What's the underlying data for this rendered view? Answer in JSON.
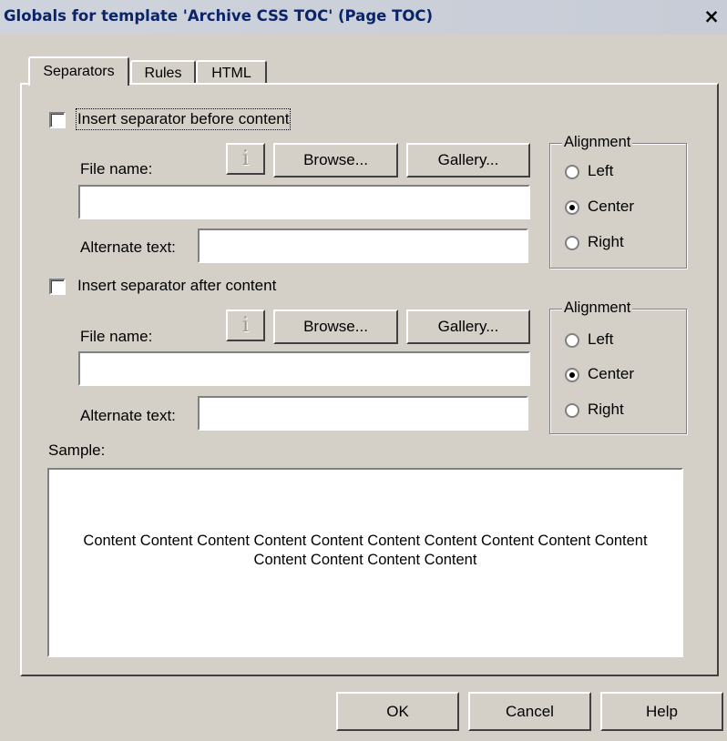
{
  "window": {
    "title": "Globals for template 'Archive CSS TOC' (Page TOC)",
    "close_glyph": "×"
  },
  "tabs": [
    {
      "label": "Separators",
      "active": true
    },
    {
      "label": "Rules",
      "active": false
    },
    {
      "label": "HTML",
      "active": false
    }
  ],
  "before": {
    "checkbox_label": "Insert separator before content",
    "checked": false,
    "file_name_label": "File name:",
    "file_name_value": "",
    "alt_text_label": "Alternate text:",
    "alt_text_value": "",
    "info_glyph": "i",
    "browse_label": "Browse...",
    "gallery_label": "Gallery...",
    "alignment": {
      "title": "Alignment",
      "options": [
        "Left",
        "Center",
        "Right"
      ],
      "selected": "Center"
    }
  },
  "after": {
    "checkbox_label": "Insert separator after content",
    "checked": false,
    "file_name_label": "File name:",
    "file_name_value": "",
    "alt_text_label": "Alternate text:",
    "alt_text_value": "",
    "info_glyph": "i",
    "browse_label": "Browse...",
    "gallery_label": "Gallery...",
    "alignment": {
      "title": "Alignment",
      "options": [
        "Left",
        "Center",
        "Right"
      ],
      "selected": "Center"
    }
  },
  "sample": {
    "label": "Sample:",
    "text": "Content Content Content Content Content Content Content Content Content Content Content Content Content Content"
  },
  "buttons": {
    "ok": "OK",
    "cancel": "Cancel",
    "help": "Help"
  }
}
